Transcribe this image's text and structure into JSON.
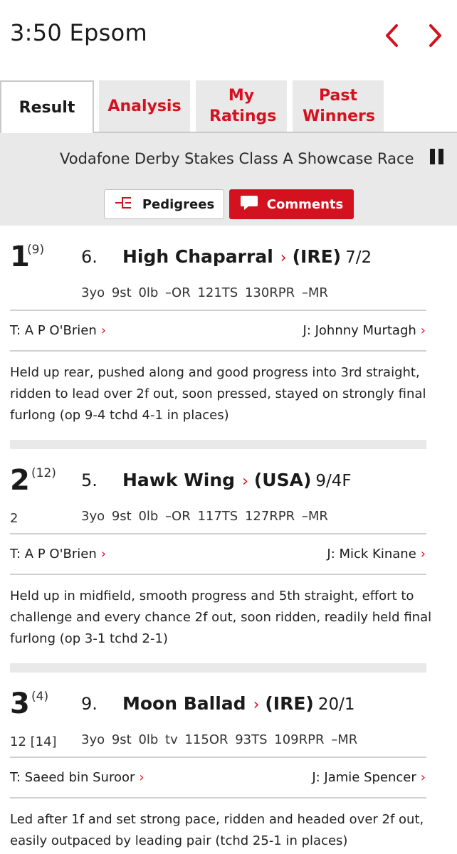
{
  "header": {
    "title": "3:50  Epsom",
    "prev_icon": "chevron-left-icon",
    "next_icon": "chevron-right-icon",
    "accent_color": "#d4121f"
  },
  "tabs": [
    {
      "label": "Result",
      "active": true
    },
    {
      "label": "Analysis",
      "active": false
    },
    {
      "label": "My Ratings",
      "active": false
    },
    {
      "label": "Past Winners",
      "active": false
    }
  ],
  "race": {
    "name": "Vodafone Derby Stakes Class A Showcase Race"
  },
  "buttons": {
    "pedigrees": "Pedigrees",
    "comments": "Comments"
  },
  "runners": [
    {
      "position": "1",
      "draw": "(9)",
      "saddle": "6.",
      "horse": "High Chaparral",
      "country": "(IRE)",
      "odds": "7/2",
      "beaten": "",
      "stats": "3yo  9st  0lb  –OR  121TS  130RPR  –MR",
      "trainer": "T: A P O'Brien",
      "jockey": "J: Johnny Murtagh",
      "comment": "Held up rear, pushed along and good progress into 3rd straight, ridden to lead over 2f out, soon pressed, stayed on strongly final furlong (op 9-4 tchd 4-1 in places)"
    },
    {
      "position": "2",
      "draw": "(12)",
      "saddle": "5.",
      "horse": "Hawk Wing",
      "country": "(USA)",
      "odds": "9/4F",
      "beaten": "2",
      "stats": "3yo  9st  0lb  –OR  117TS  127RPR  –MR",
      "trainer": "T: A P O'Brien",
      "jockey": "J: Mick Kinane",
      "comment": "Held up in midfield, smooth progress and 5th straight, effort to challenge and every chance 2f out, soon ridden, readily held final furlong (op 3-1 tchd 2-1)"
    },
    {
      "position": "3",
      "draw": "(4)",
      "saddle": "9.",
      "horse": "Moon Ballad",
      "country": "(IRE)",
      "odds": "20/1",
      "beaten": "12 [14]",
      "stats": "3yo  9st  0lb tv  115OR  93TS  109RPR  –MR",
      "trainer": "T: Saeed bin Suroor",
      "jockey": "J: Jamie Spencer",
      "comment": "Led after 1f and set strong pace, ridden and headed over 2f out, easily outpaced by leading pair (tchd 25-1 in places)"
    }
  ]
}
